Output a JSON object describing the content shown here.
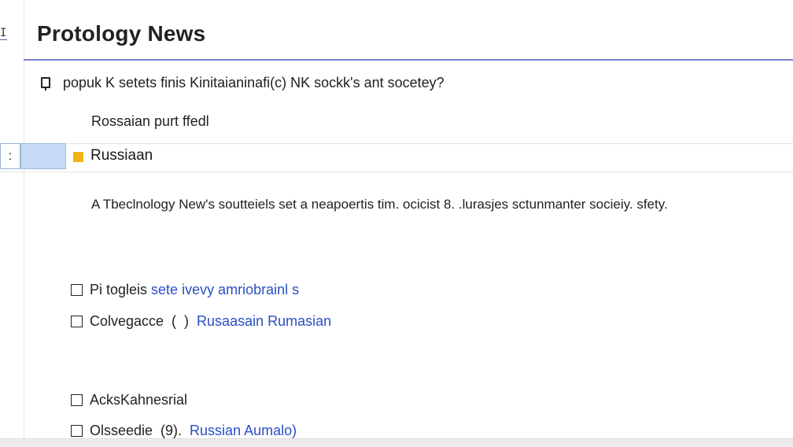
{
  "app": {
    "title": "Protology News",
    "rail_glyph": "I"
  },
  "question": {
    "text": "popuk K setets finis Kinitaianinafi(c) NK sockk's ant socetey?"
  },
  "subtitle": "Rossaian purt ffedl",
  "selected_row": {
    "handle": ":",
    "tag_color": "#f0b414",
    "label": "Russiaan"
  },
  "summary": "A Tbeclnology New's soutteiels set a neapoertis tim. ocicist 8. .lurasjes sctunmanter socieiy. sfety.",
  "options": [
    {
      "text": "Pi togleis ",
      "link": "sete ivevy amriobrainl s"
    },
    {
      "text": "Colvegacce  (  )  ",
      "link": "Rusaasain Rumasian"
    },
    {
      "text": "AcksKahnesrial",
      "link": ""
    },
    {
      "text": "Olsseedie  (9).  ",
      "link": "Russian Aumalo)"
    }
  ],
  "colors": {
    "accent_rule": "#7b7fd0",
    "link": "#2a4fc4",
    "selection": "#c6dcf6"
  }
}
